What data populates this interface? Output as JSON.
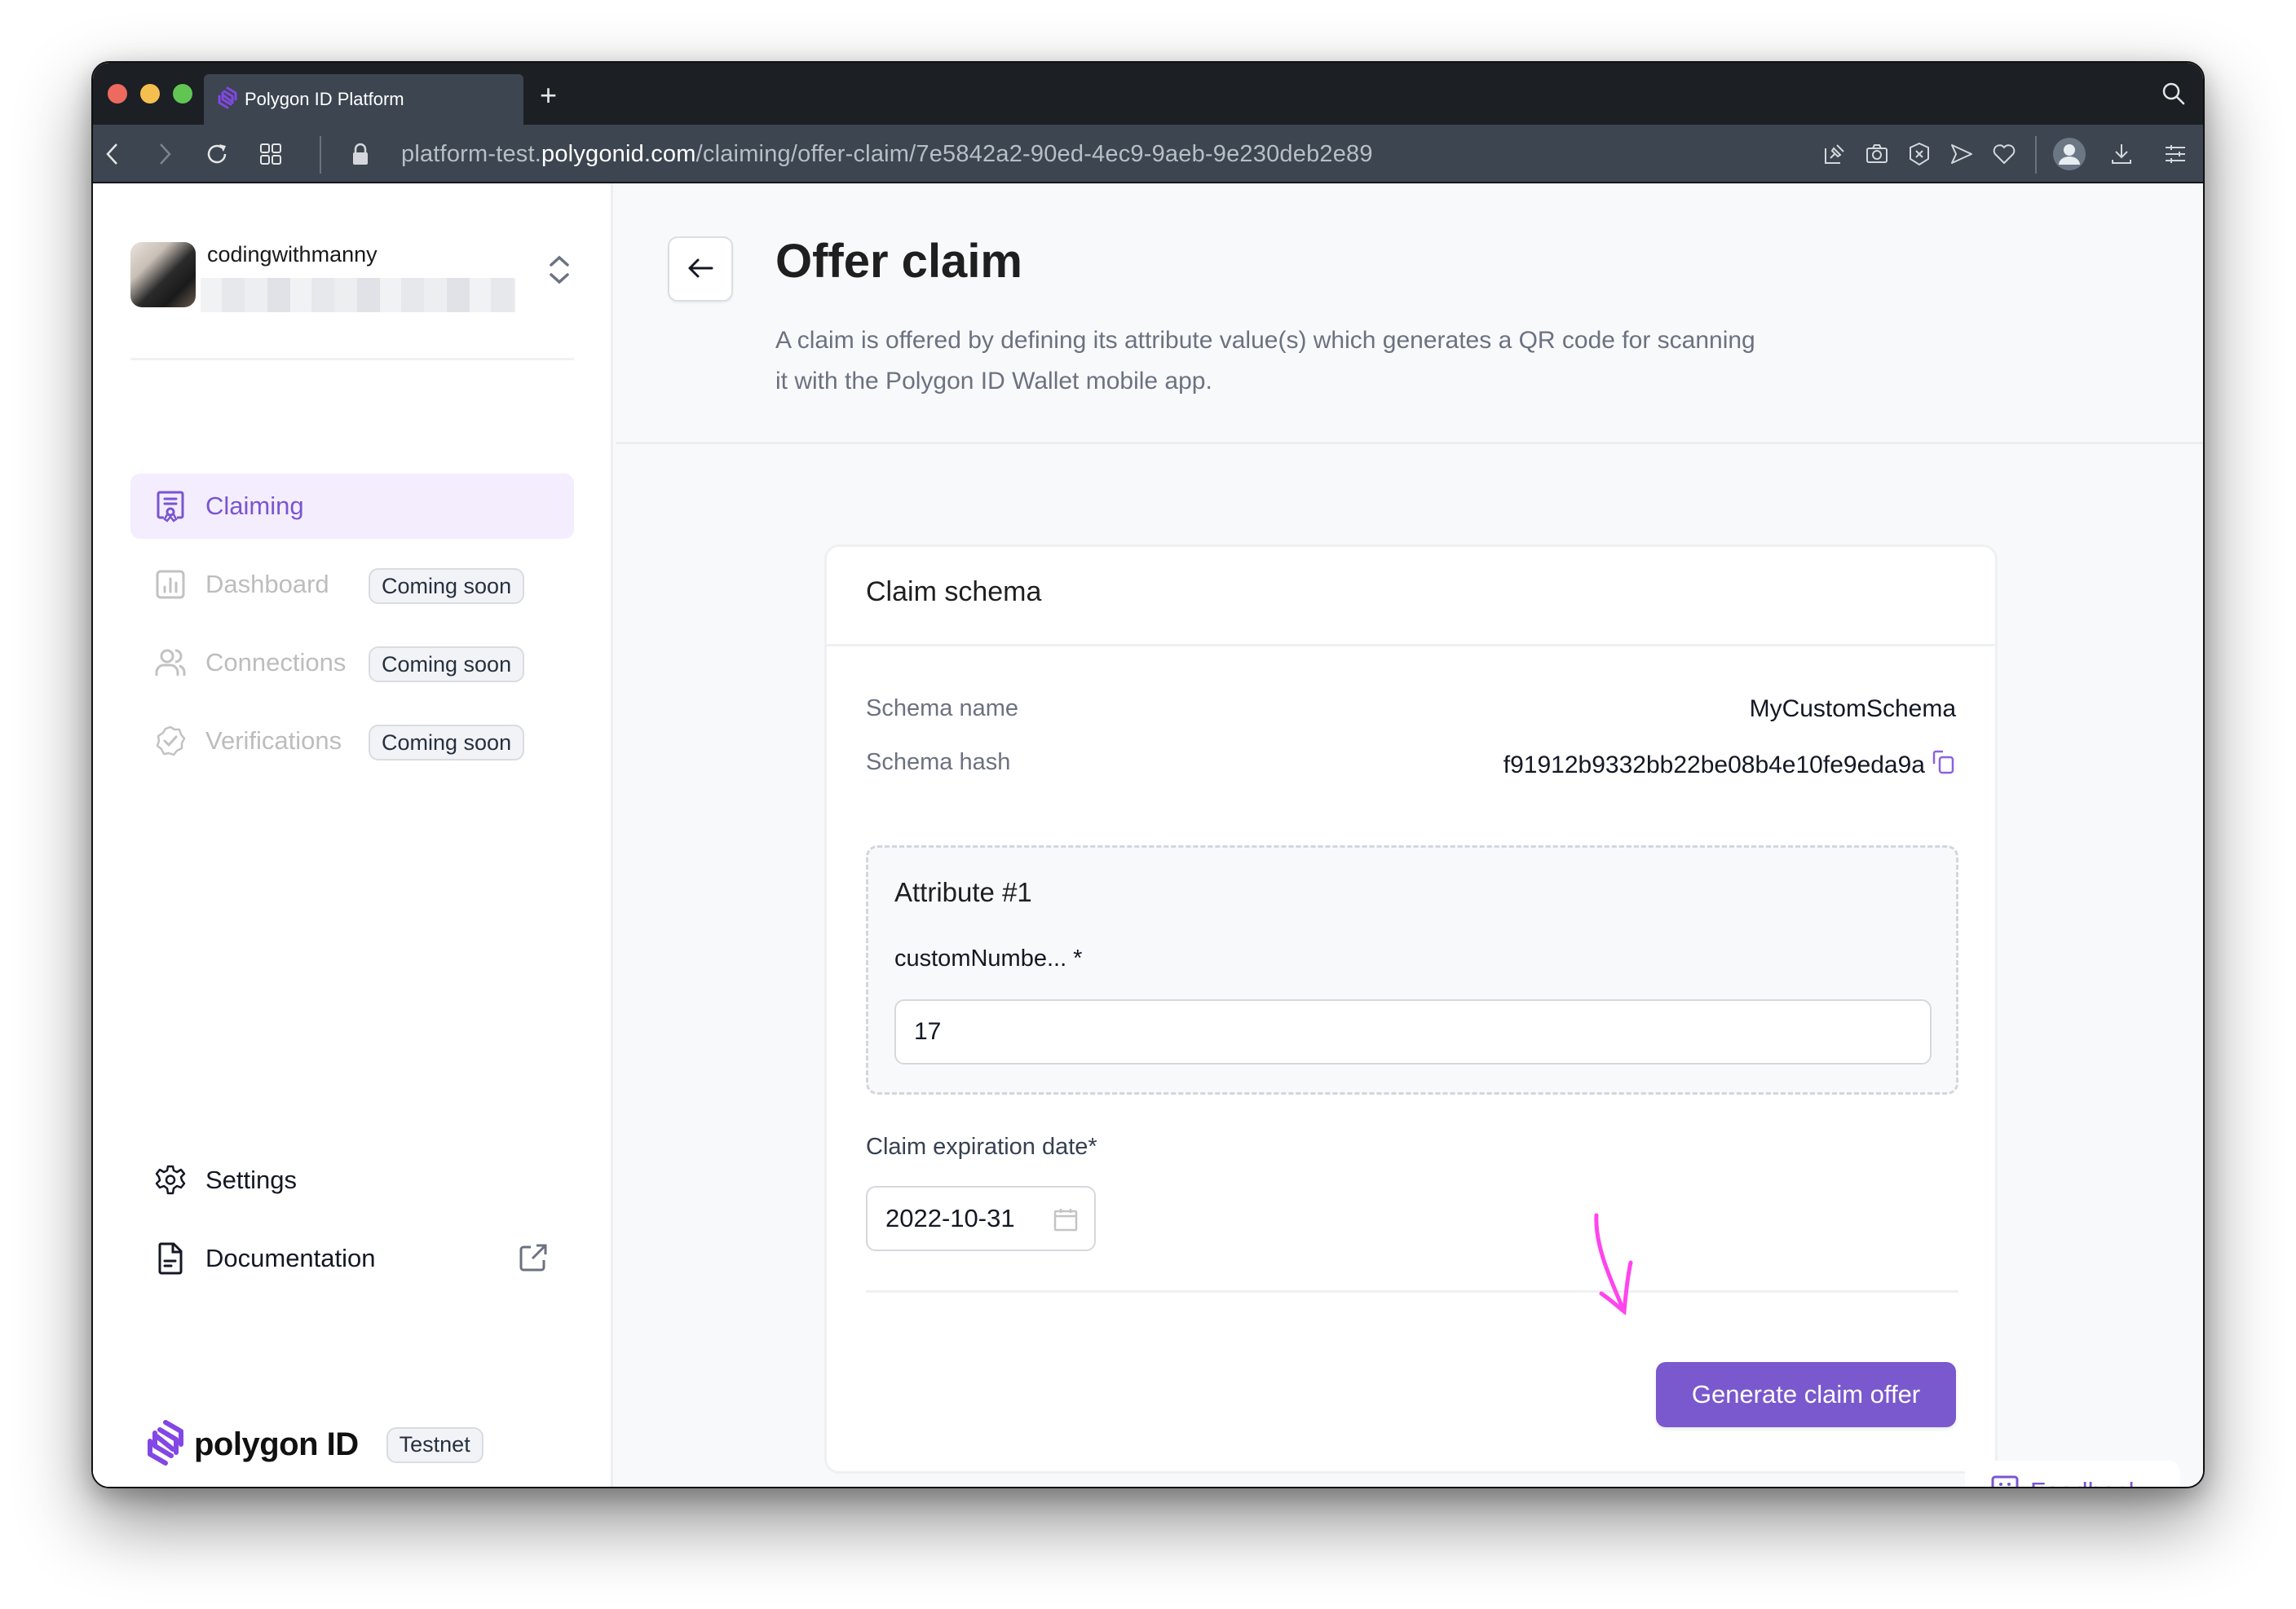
{
  "browser": {
    "tab_title": "Polygon ID Platform",
    "new_tab_label": "+",
    "url_prefix": "platform-test.",
    "url_host": "polygonid.com",
    "url_path": "/claiming/offer-claim/7e5842a2-90ed-4ec9-9aeb-9e230deb2e89",
    "toolbar_icons": [
      "back-icon",
      "forward-icon",
      "reload-icon",
      "grid-icon",
      "lock-icon",
      "pin-icon",
      "camera-icon",
      "shield-x-icon",
      "send-icon",
      "heart-icon",
      "profile-icon",
      "download-icon",
      "menu-icon",
      "search-icon"
    ]
  },
  "sidebar": {
    "account": {
      "name": "codingwithmanny",
      "subtitle_redacted": true
    },
    "nav": [
      {
        "label": "Claiming",
        "icon": "certificate-icon",
        "active": true,
        "badge": null
      },
      {
        "label": "Dashboard",
        "icon": "chart-icon",
        "active": false,
        "badge": "Coming soon"
      },
      {
        "label": "Connections",
        "icon": "users-icon",
        "active": false,
        "badge": "Coming soon"
      },
      {
        "label": "Verifications",
        "icon": "badge-check-icon",
        "active": false,
        "badge": "Coming soon"
      }
    ],
    "bottom": [
      {
        "label": "Settings",
        "icon": "gear-icon"
      },
      {
        "label": "Documentation",
        "icon": "document-icon",
        "external": true
      }
    ],
    "brand": {
      "name": "polygon ID",
      "badge": "Testnet"
    }
  },
  "header": {
    "title": "Offer claim",
    "description": "A claim is offered by defining its attribute value(s) which generates a QR code for scanning it with the Polygon ID Wallet mobile app."
  },
  "card": {
    "title": "Claim schema",
    "fields": [
      {
        "label": "Schema name",
        "value": "MyCustomSchema"
      },
      {
        "label": "Schema hash",
        "value": "f91912b9332bb22be08b4e10fe9eda9a"
      }
    ],
    "attribute": {
      "title": "Attribute #1",
      "label": "customNumbe... *",
      "value": "17"
    },
    "expiration": {
      "label": "Claim expiration date*",
      "value": "2022-10-31"
    },
    "submit_label": "Generate claim offer"
  },
  "feedback_label": "Feedback",
  "colors": {
    "accent": "#7a58cd",
    "accent_light": "#f3edfd",
    "annotation": "#ff44ee"
  }
}
